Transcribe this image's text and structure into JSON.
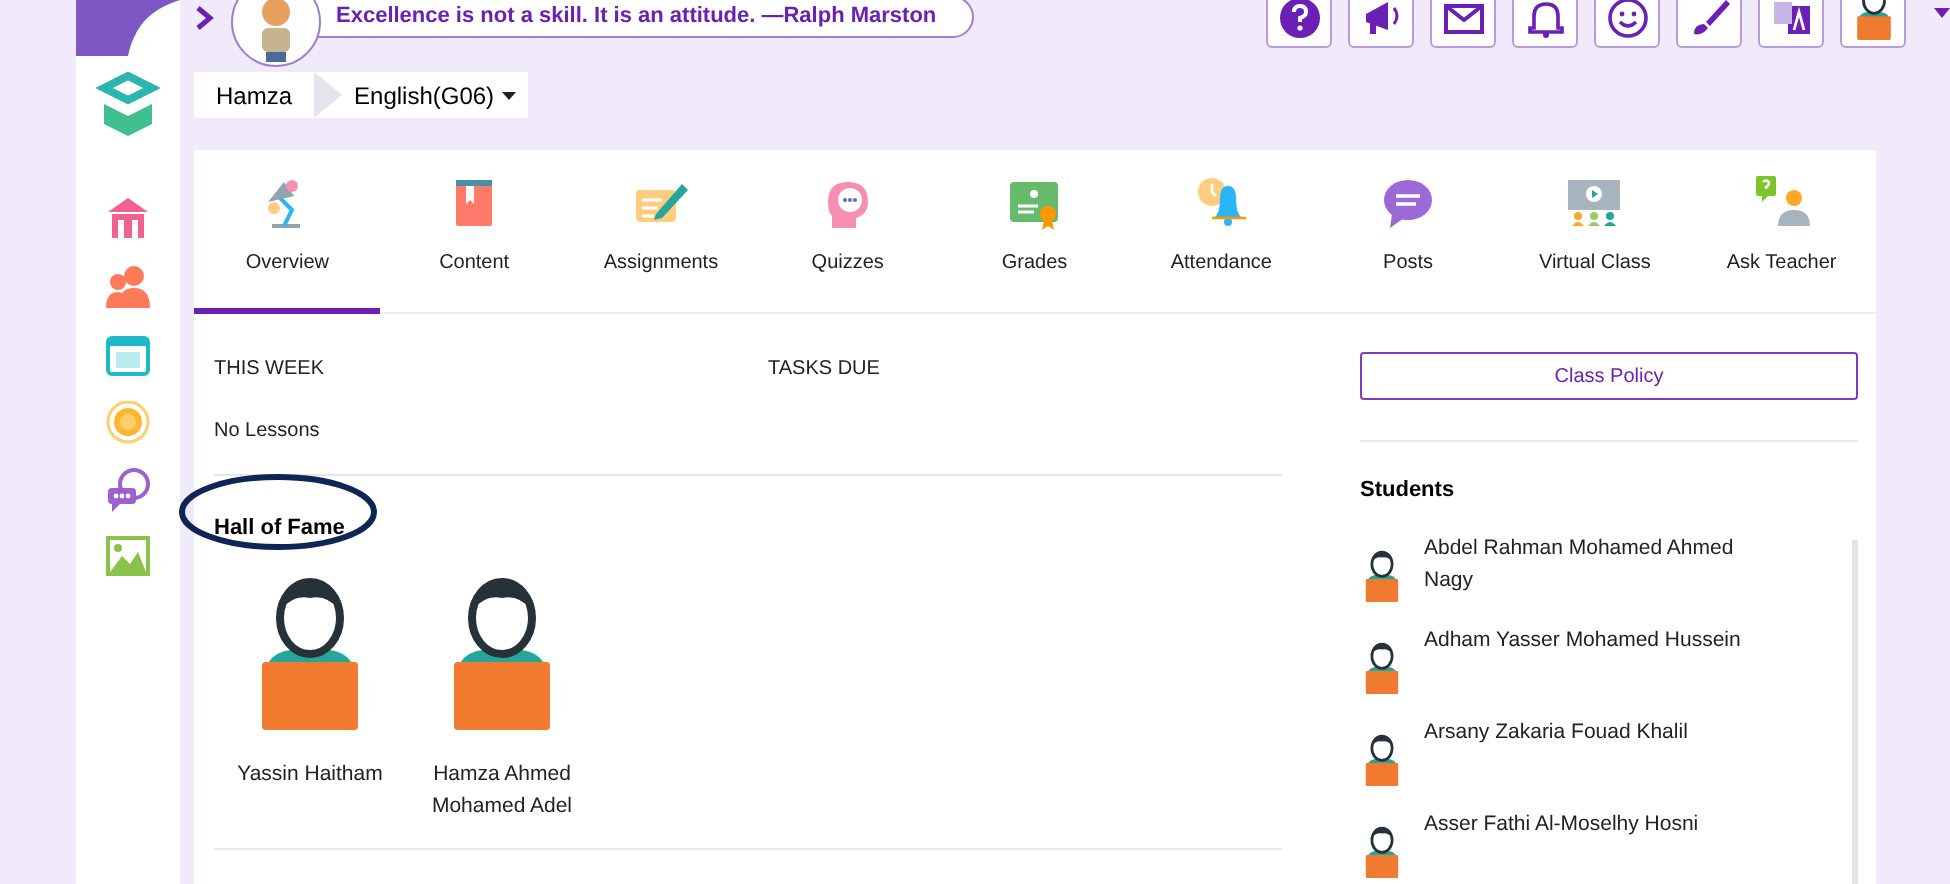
{
  "quote": "Excellence is not a skill. It is an attitude. —Ralph Marston",
  "breadcrumb": {
    "user": "Hamza",
    "course": "English(G06)"
  },
  "tabs": [
    {
      "label": "Overview",
      "selected": true
    },
    {
      "label": "Content",
      "selected": false
    },
    {
      "label": "Assignments",
      "selected": false
    },
    {
      "label": "Quizzes",
      "selected": false
    },
    {
      "label": "Grades",
      "selected": false
    },
    {
      "label": "Attendance",
      "selected": false
    },
    {
      "label": "Posts",
      "selected": false
    },
    {
      "label": "Virtual Class",
      "selected": false
    },
    {
      "label": "Ask Teacher",
      "selected": false
    }
  ],
  "this_week": {
    "heading": "THIS WEEK",
    "text": "No Lessons"
  },
  "tasks_due": {
    "heading": "TASKS DUE"
  },
  "hall_of_fame": {
    "heading": "Hall of Fame",
    "students": [
      {
        "name": "Yassin Haitham"
      },
      {
        "name": "Hamza Ahmed Mohamed Adel"
      }
    ]
  },
  "class_policy_button": "Class Policy",
  "students": {
    "heading": "Students",
    "items": [
      {
        "name": "Abdel Rahman Mohamed Ahmed Nagy"
      },
      {
        "name": "Adham Yasser Mohamed Hussein"
      },
      {
        "name": "Arsany Zakaria Fouad Khalil"
      },
      {
        "name": "Asser Fathi Al-Moselhy Hosni"
      }
    ]
  }
}
